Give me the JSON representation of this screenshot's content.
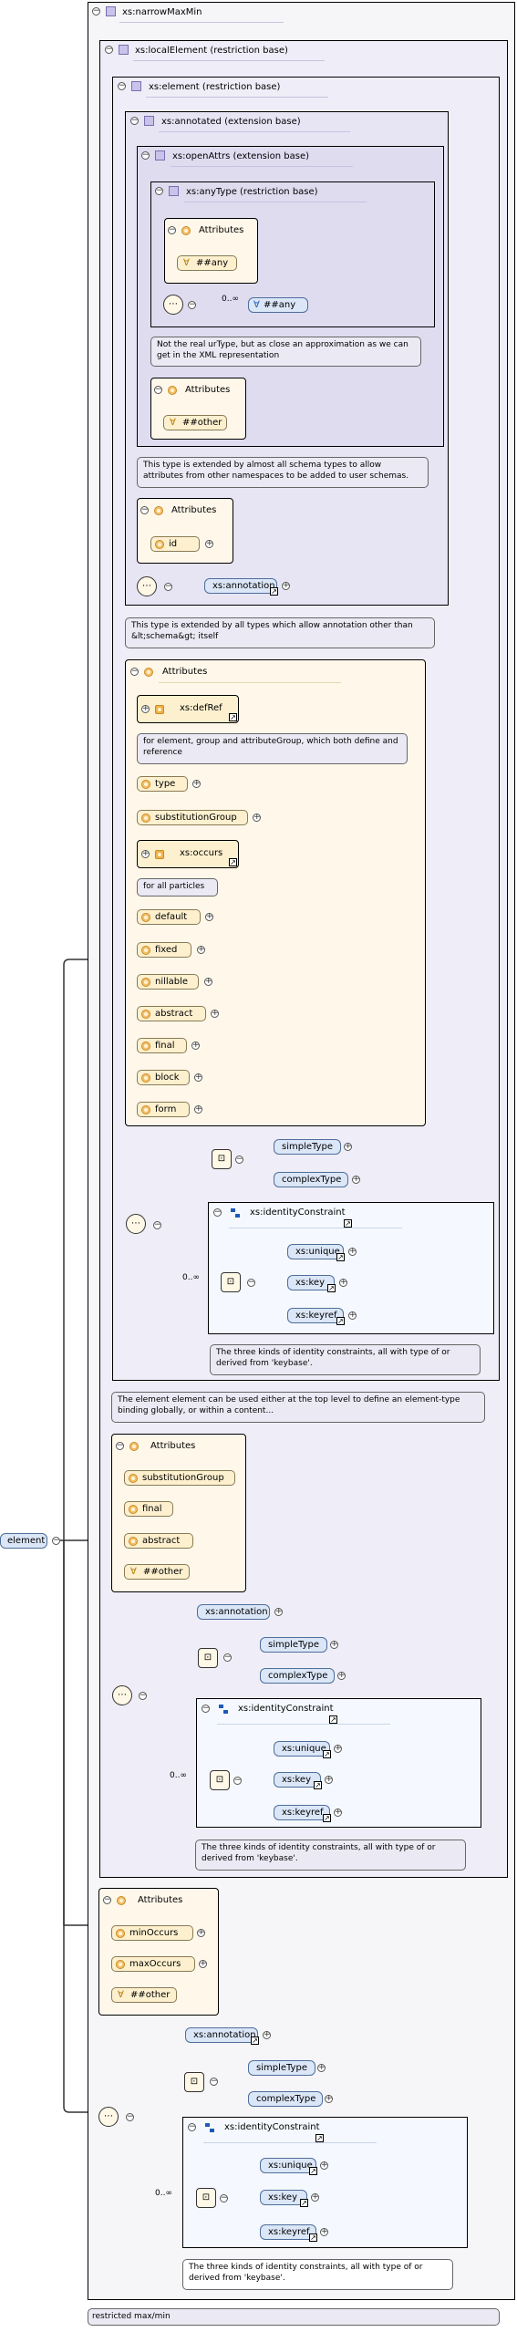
{
  "root": {
    "label": "element"
  },
  "outer": {
    "title": "xs:narrowMaxMin",
    "footer": "restricted max/min"
  },
  "local_element": {
    "title": "xs:localElement (restriction base)"
  },
  "element": {
    "title": "xs:element (restriction base)"
  },
  "annotated": {
    "title": "xs:annotated (extension base)"
  },
  "open_attrs": {
    "title": "xs:openAttrs (extension base)"
  },
  "any_type": {
    "title": "xs:anyType (restriction base)",
    "attributes_title": "Attributes",
    "any_attr": "##any",
    "occurs": "0..∞",
    "any_elem": "##any",
    "tip": "Not the real urType, but as close an approximation as we can get in the XML representation"
  },
  "open_attrs_attrs": {
    "title": "Attributes",
    "other": "##other",
    "tip": "This type is extended by almost all schema types to allow attributes from other namespaces to be added to user schemas."
  },
  "annotated_attrs": {
    "title": "Attributes",
    "id": "id",
    "annotation": "xs:annotation",
    "tip": "This type is extended by all types which allow annotation other than &lt;schema&gt; itself"
  },
  "element_attrs": {
    "title": "Attributes",
    "defRef": "xs:defRef",
    "defRef_tip": "for element, group and attributeGroup, which both define and reference",
    "type": "type",
    "substitutionGroup": "substitutionGroup",
    "occurs": "xs:occurs",
    "occurs_tip": "for all particles",
    "default": "default",
    "fixed": "fixed",
    "nillable": "nillable",
    "abstract": "abstract",
    "final": "final",
    "block": "block",
    "form": "form"
  },
  "element_seq": {
    "simpleType": "simpleType",
    "complexType": "complexType",
    "identity": "xs:identityConstraint",
    "unique": "xs:unique",
    "key": "xs:key",
    "keyref": "xs:keyref",
    "occurs": "0..∞",
    "identity_tip": "The three kinds of identity constraints, all with type of or derived from 'keybase'."
  },
  "element_tip": "The element element can be used either at the top level to define an element-type binding globally, or within a content...",
  "local_attrs": {
    "title": "Attributes",
    "substitutionGroup": "substitutionGroup",
    "final": "final",
    "abstract": "abstract",
    "other": "##other"
  },
  "local_seq": {
    "annotation": "xs:annotation",
    "simpleType": "simpleType",
    "complexType": "complexType",
    "identity": "xs:identityConstraint",
    "unique": "xs:unique",
    "key": "xs:key",
    "keyref": "xs:keyref",
    "occurs": "0..∞",
    "identity_tip": "The three kinds of identity constraints, all with type of or derived from 'keybase'."
  },
  "narrow_attrs": {
    "title": "Attributes",
    "minOccurs": "minOccurs",
    "maxOccurs": "maxOccurs",
    "other": "##other"
  },
  "narrow_seq": {
    "annotation": "xs:annotation",
    "simpleType": "simpleType",
    "complexType": "complexType",
    "identity": "xs:identityConstraint",
    "unique": "xs:unique",
    "key": "xs:key",
    "keyref": "xs:keyref",
    "occurs": "0..∞",
    "identity_tip": "The three kinds of identity constraints, all with type of or derived from 'keybase'."
  }
}
